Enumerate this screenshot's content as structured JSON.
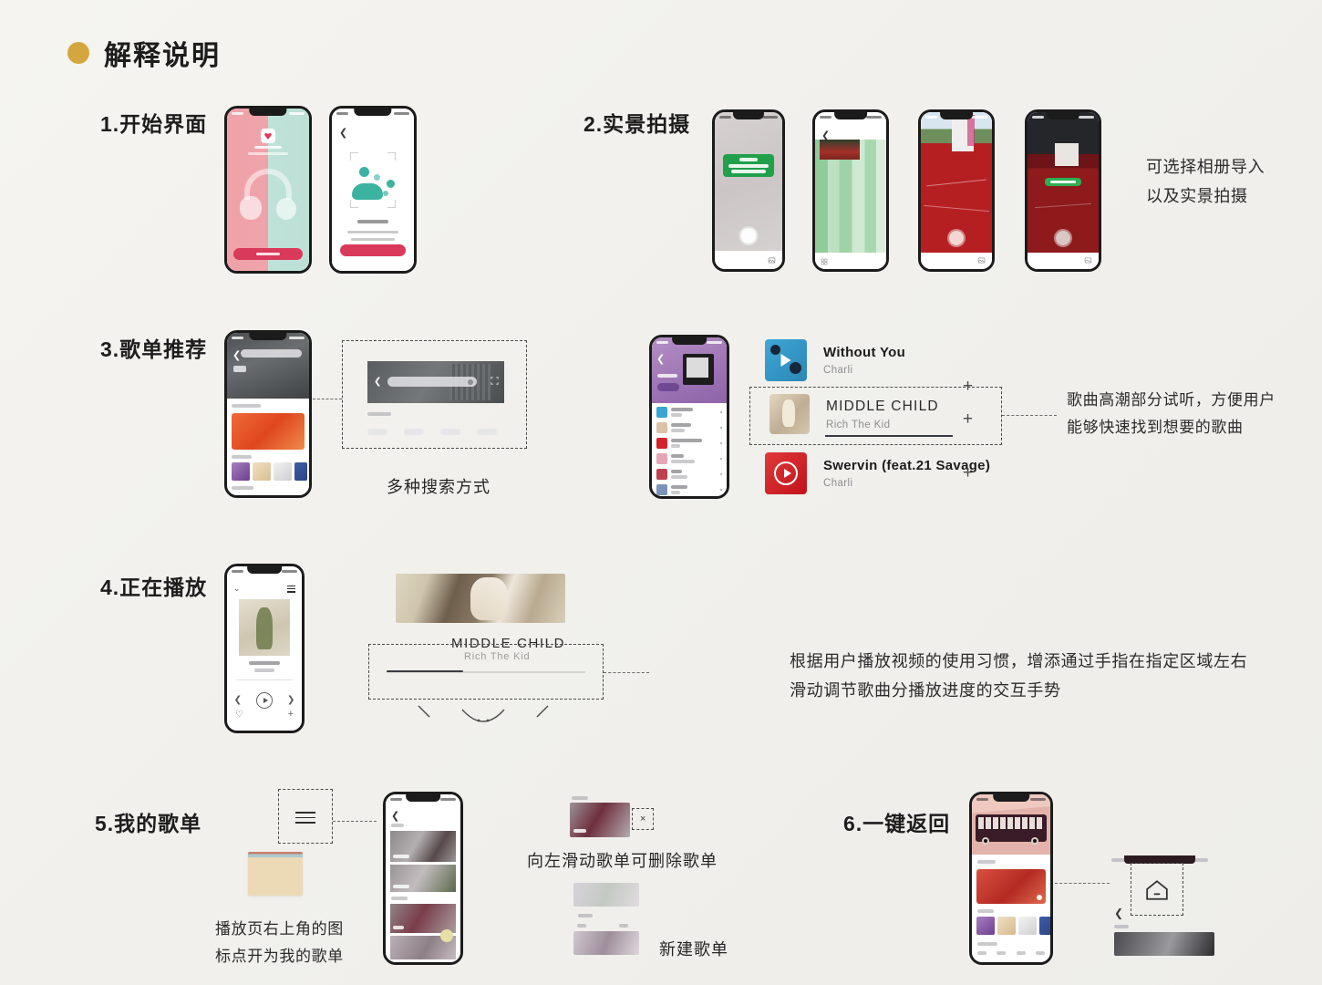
{
  "page": {
    "title": "解释说明",
    "accent_color": "#d4a63f",
    "background": "#f2f1ed"
  },
  "sections": [
    {
      "id": "s1",
      "label": "1.开始界面",
      "phones": [
        {
          "name": "welcome-split-screen",
          "bg_left": "#f0a2a9",
          "bg_right": "#bfe2d8",
          "cta_color": "#d9395a"
        },
        {
          "name": "scan-intro-screen",
          "bg": "#ffffff",
          "illo_color": "#3bb3a0",
          "cta_color": "#d9395a"
        }
      ]
    },
    {
      "id": "s2",
      "label": "2.实景拍摄",
      "note": "可选择相册导入\n以及实景拍摄",
      "phones": [
        {
          "name": "camera-grey-wall",
          "toast_color": "#20a04a"
        },
        {
          "name": "gallery-green-grid"
        },
        {
          "name": "camera-track-red"
        },
        {
          "name": "camera-track-dark",
          "toast_color": "#2fae55"
        }
      ]
    },
    {
      "id": "s3",
      "label": "3.歌单推荐",
      "caption_search": "多种搜索方式",
      "note_preview": "歌曲高潮部分试听，方便用户\n能够快速找到想要的歌曲",
      "songs": [
        {
          "title": "Without You",
          "artist": "Charli",
          "thumb_color": "#3aa5d0",
          "add_label": "+",
          "highlighted": false
        },
        {
          "title": "MIDDLE CHILD",
          "artist": "Rich The Kid",
          "thumb_color": "#c9b49a",
          "add_label": "+",
          "highlighted": true
        },
        {
          "title": "Swervin (feat.21 Savage)",
          "artist": "Charli",
          "thumb_color": "#d2232a",
          "add_label": "+",
          "highlighted": false
        }
      ]
    },
    {
      "id": "s4",
      "label": "4.正在播放",
      "now_playing": {
        "title": "MIDDLE CHILD",
        "artist": "Rich The Kid",
        "progress_percent": 38
      },
      "note": "根据用户播放视频的使用习惯，增添通过手指在指定区域左右\n滑动调节歌曲分播放进度的交互手势"
    },
    {
      "id": "s5",
      "label": "5.我的歌单",
      "note_menu": "播放页右上角的图\n标点开为我的歌单",
      "caption_swipe": "向左滑动歌单可删除歌单",
      "caption_create": "新建歌单",
      "delete_mark": "×",
      "menu_icon": "hamburger-icon"
    },
    {
      "id": "s6",
      "label": "6.一键返回",
      "home_icon": "home-icon"
    }
  ]
}
